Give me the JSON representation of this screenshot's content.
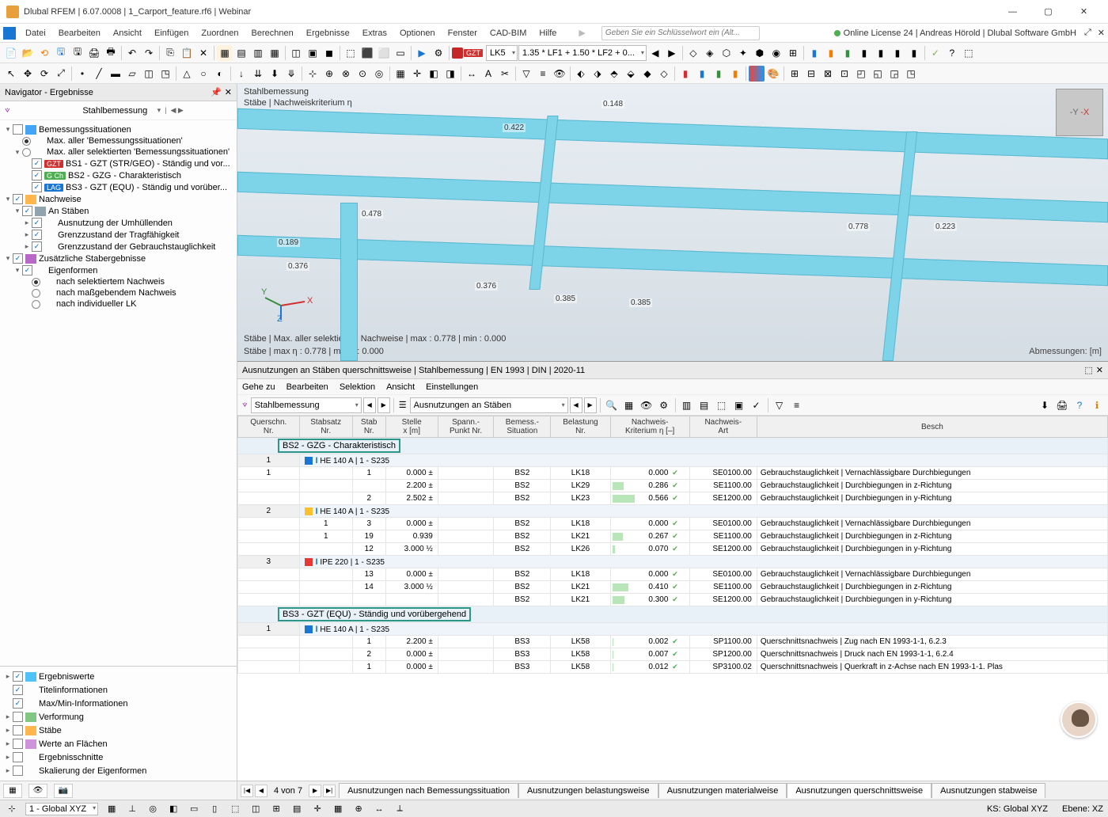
{
  "window": {
    "title": "Dlubal RFEM | 6.07.0008 | 1_Carport_feature.rf6 | Webinar",
    "license": "Online License 24 | Andreas Hörold | Dlubal Software GmbH"
  },
  "menu": [
    "Datei",
    "Bearbeiten",
    "Ansicht",
    "Einfügen",
    "Zuordnen",
    "Berechnen",
    "Ergebnisse",
    "Extras",
    "Optionen",
    "Fenster",
    "CAD-BIM",
    "Hilfe"
  ],
  "search_placeholder": "Geben Sie ein Schlüsselwort ein (Alt...",
  "toolbar2": {
    "gzt": "GZT",
    "lk": "LK5",
    "combo": "1.35 * LF1 + 1.50 * LF2 + 0..."
  },
  "navigator": {
    "title": "Navigator - Ergebnisse",
    "combo": "Stahlbemessung",
    "tree": {
      "root1": "Bemessungssituationen",
      "r1a": "Max. aller 'Bemessungssituationen'",
      "r1b": "Max. aller selektierten 'Bemessungssituationen'",
      "bs1": "BS1 - GZT (STR/GEO) - Ständig und vor...",
      "bs2": "BS2 - GZG - Charakteristisch",
      "bs3": "BS3 - GZT (EQU) - Ständig und vorüber...",
      "root2": "Nachweise",
      "st": "An Stäben",
      "u1": "Ausnutzung der Umhüllenden",
      "u2": "Grenzzustand der Tragfähigkeit",
      "u3": "Grenzzustand der Gebrauchstauglichkeit",
      "root3": "Zusätzliche Stabergebnisse",
      "ef": "Eigenformen",
      "e1": "nach selektiertem Nachweis",
      "e2": "nach maßgebendem Nachweis",
      "e3": "nach individueller LK"
    },
    "bottom": [
      "Ergebniswerte",
      "Titelinformationen",
      "Max/Min-Informationen",
      "Verformung",
      "Stäbe",
      "Werte an Flächen",
      "Ergebnisschnitte",
      "Skalierung der Eigenformen"
    ]
  },
  "viewport": {
    "title": "Stahlbemessung",
    "sub": "Stäbe | Nachweiskriterium η",
    "stats1": "Stäbe | Max. aller selektierten Nachweise | max  : 0.778 | min  : 0.000",
    "stats2": "Stäbe | max η : 0.778 | min η : 0.000",
    "dim": "Abmessungen: [m]",
    "annots": [
      "0.148",
      "0.422",
      "0.778",
      "0.223",
      "0.189",
      "0.478",
      "0.376",
      "0.376",
      "0.385",
      "0.385"
    ]
  },
  "results": {
    "title": "Ausnutzungen an Stäben querschnittsweise | Stahlbemessung | EN 1993 | DIN | 2020-11",
    "menu": [
      "Gehe zu",
      "Bearbeiten",
      "Selektion",
      "Ansicht",
      "Einstellungen"
    ],
    "combo1": "Stahlbemessung",
    "combo2": "Ausnutzungen an Stäben",
    "columns": [
      "Querschn.\nNr.",
      "Stabsatz\nNr.",
      "Stab\nNr.",
      "Stelle\nx [m]",
      "Spann.-\nPunkt Nr.",
      "Bemess.-\nSituation",
      "Belastung\nNr.",
      "Nachweis-\nKriterium η [–]",
      "Nachweis-\nArt",
      "Besch"
    ],
    "group1": "BS2 - GZG - Charakteristisch",
    "sect1": "HE 140 A | 1 - S235",
    "rows1": [
      {
        "q": "1",
        "ss": "",
        "st": "1",
        "x": "0.000",
        "sp": "±",
        "bs": "BS2",
        "lk": "LK18",
        "eta": "0.000",
        "code": "SE0100.00",
        "desc": "Gebrauchstauglichkeit | Vernachlässigbare Durchbiegungen"
      },
      {
        "q": "",
        "ss": "",
        "st": "",
        "x": "2.200",
        "sp": "±",
        "bs": "BS2",
        "lk": "LK29",
        "eta": "0.286",
        "code": "SE1100.00",
        "desc": "Gebrauchstauglichkeit | Durchbiegungen in z-Richtung"
      },
      {
        "q": "",
        "ss": "",
        "st": "2",
        "x": "2.502",
        "sp": "±",
        "bs": "BS2",
        "lk": "LK23",
        "eta": "0.566",
        "code": "SE1200.00",
        "desc": "Gebrauchstauglichkeit | Durchbiegungen in y-Richtung"
      }
    ],
    "sect2_q": "2",
    "sect2": "HE 140 A | 1 - S235",
    "rows2": [
      {
        "q": "",
        "ss": "1",
        "st": "3",
        "x": "0.000",
        "sp": "±",
        "bs": "BS2",
        "lk": "LK18",
        "eta": "0.000",
        "code": "SE0100.00",
        "desc": "Gebrauchstauglichkeit | Vernachlässigbare Durchbiegungen"
      },
      {
        "q": "",
        "ss": "1",
        "st": "19",
        "x": "0.939",
        "sp": "",
        "bs": "BS2",
        "lk": "LK21",
        "eta": "0.267",
        "code": "SE1100.00",
        "desc": "Gebrauchstauglichkeit | Durchbiegungen in z-Richtung"
      },
      {
        "q": "",
        "ss": "",
        "st": "12",
        "x": "3.000",
        "sp": "½",
        "bs": "BS2",
        "lk": "LK26",
        "eta": "0.070",
        "code": "SE1200.00",
        "desc": "Gebrauchstauglichkeit | Durchbiegungen in y-Richtung"
      }
    ],
    "sect3_q": "3",
    "sect3": "IPE 220 | 1 - S235",
    "rows3": [
      {
        "q": "",
        "ss": "",
        "st": "13",
        "x": "0.000",
        "sp": "±",
        "bs": "BS2",
        "lk": "LK18",
        "eta": "0.000",
        "code": "SE0100.00",
        "desc": "Gebrauchstauglichkeit | Vernachlässigbare Durchbiegungen"
      },
      {
        "q": "",
        "ss": "",
        "st": "14",
        "x": "3.000",
        "sp": "½",
        "bs": "BS2",
        "lk": "LK21",
        "eta": "0.410",
        "code": "SE1100.00",
        "desc": "Gebrauchstauglichkeit | Durchbiegungen in z-Richtung"
      },
      {
        "q": "",
        "ss": "",
        "st": "",
        "x": "",
        "sp": "",
        "bs": "BS2",
        "lk": "LK21",
        "eta": "0.300",
        "code": "SE1200.00",
        "desc": "Gebrauchstauglichkeit | Durchbiegungen in y-Richtung"
      }
    ],
    "group2": "BS3 - GZT (EQU) - Ständig und vorübergehend",
    "sect4_q": "1",
    "sect4": "HE 140 A | 1 - S235",
    "rows4": [
      {
        "q": "",
        "ss": "",
        "st": "1",
        "x": "2.200",
        "sp": "±",
        "bs": "BS3",
        "lk": "LK58",
        "eta": "0.002",
        "code": "SP1100.00",
        "desc": "Querschnittsnachweis | Zug nach EN 1993-1-1, 6.2.3"
      },
      {
        "q": "",
        "ss": "",
        "st": "2",
        "x": "0.000",
        "sp": "±",
        "bs": "BS3",
        "lk": "LK58",
        "eta": "0.007",
        "code": "SP1200.00",
        "desc": "Querschnittsnachweis | Druck nach EN 1993-1-1, 6.2.4"
      },
      {
        "q": "",
        "ss": "",
        "st": "1",
        "x": "0.000",
        "sp": "±",
        "bs": "BS3",
        "lk": "LK58",
        "eta": "0.012",
        "code": "SP3100.02",
        "desc": "Querschnittsnachweis | Querkraft in z-Achse nach EN 1993-1-1.   Plas"
      }
    ],
    "pager": "4 von 7",
    "tabs": [
      "Ausnutzungen nach Bemessungssituation",
      "Ausnutzungen belastungsweise",
      "Ausnutzungen materialweise",
      "Ausnutzungen querschnittsweise",
      "Ausnutzungen stabweise"
    ]
  },
  "statusbar": {
    "cs": "1 - Global XYZ",
    "ks": "KS: Global XYZ",
    "ebene": "Ebene: XZ"
  }
}
